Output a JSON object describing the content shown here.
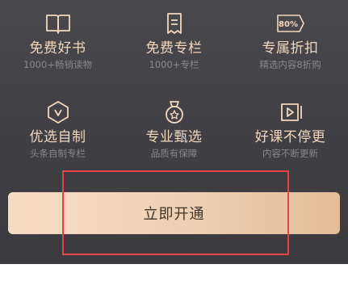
{
  "benefits": [
    {
      "icon": "open-book-icon",
      "title": "免费好书",
      "subtitle": "1000+畅销读物"
    },
    {
      "icon": "document-icon",
      "title": "免费专栏",
      "subtitle": "1000+专栏"
    },
    {
      "icon": "discount-tag-icon",
      "title": "专属折扣",
      "subtitle": "精选内容8折购",
      "badge": "80%"
    },
    {
      "icon": "hexagon-v-icon",
      "title": "优选自制",
      "subtitle": "头条自制专栏"
    },
    {
      "icon": "medal-icon",
      "title": "专业甄选",
      "subtitle": "品质有保障"
    },
    {
      "icon": "play-video-icon",
      "title": "好课不停更",
      "subtitle": "内容不断更新"
    }
  ],
  "cta": {
    "label": "立即开通"
  },
  "colors": {
    "panel_bg": "#434348",
    "title_text": "#f2d8bf",
    "subtitle_text": "#88888c",
    "button_gradient_start": "#f7dcc4",
    "button_gradient_end": "#e4bd98",
    "highlight_border": "#e8414a"
  }
}
